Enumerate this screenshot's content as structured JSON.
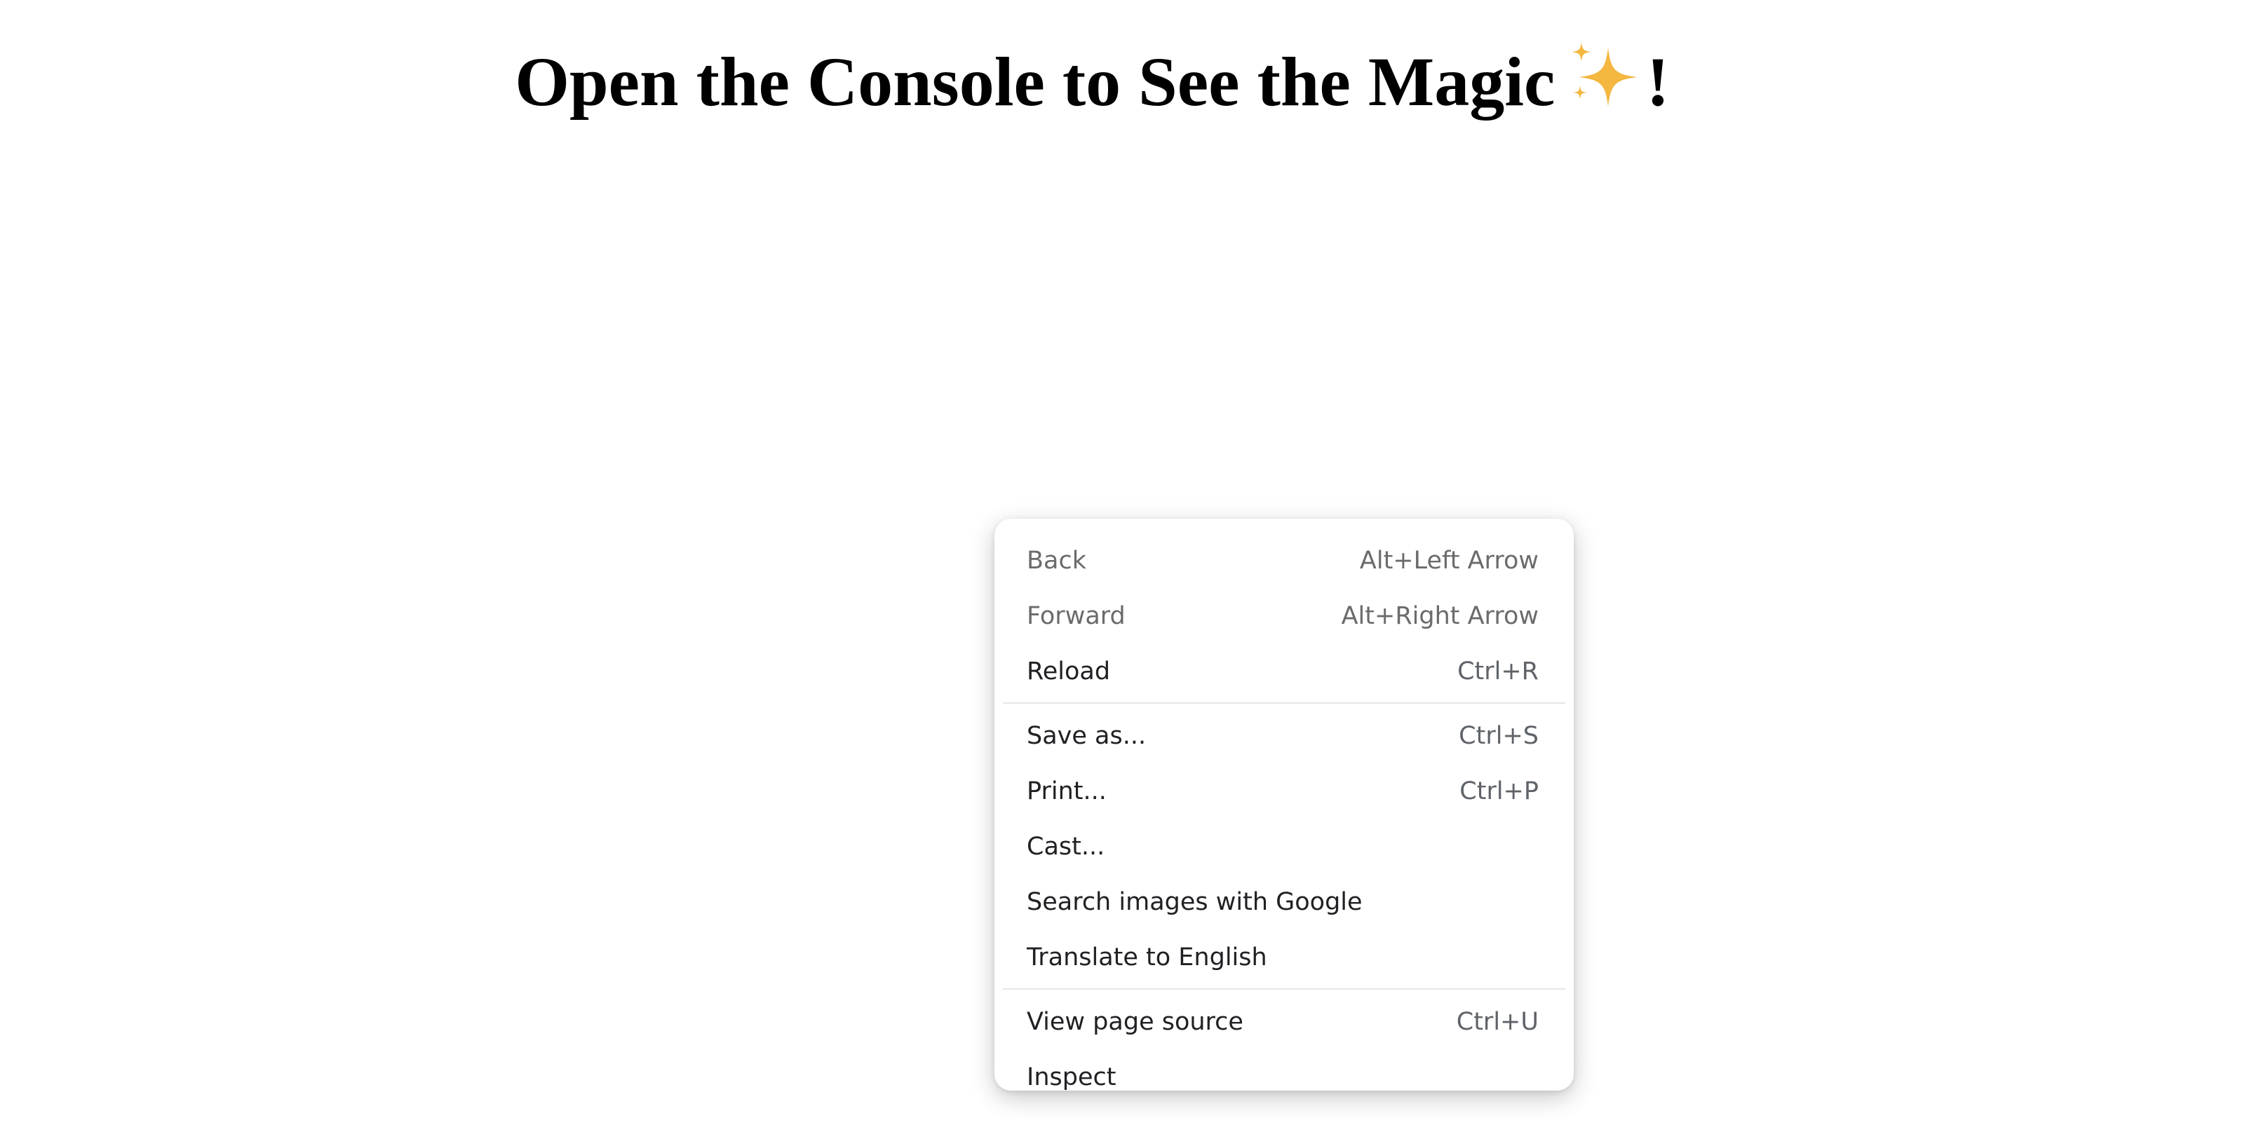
{
  "page": {
    "heading": "Open the Console to See the Magic",
    "heading_suffix": "!",
    "heading_icon": "sparkles-emoji",
    "accent_color": "#F4B73F"
  },
  "context_menu": {
    "groups": [
      {
        "items": [
          {
            "label": "Back",
            "shortcut": "Alt+Left Arrow",
            "enabled": false
          },
          {
            "label": "Forward",
            "shortcut": "Alt+Right Arrow",
            "enabled": false
          },
          {
            "label": "Reload",
            "shortcut": "Ctrl+R",
            "enabled": true
          }
        ]
      },
      {
        "items": [
          {
            "label": "Save as...",
            "shortcut": "Ctrl+S",
            "enabled": true
          },
          {
            "label": "Print...",
            "shortcut": "Ctrl+P",
            "enabled": true
          },
          {
            "label": "Cast...",
            "shortcut": "",
            "enabled": true
          },
          {
            "label": "Search images with Google",
            "shortcut": "",
            "enabled": true
          },
          {
            "label": "Translate to English",
            "shortcut": "",
            "enabled": true
          }
        ]
      },
      {
        "items": [
          {
            "label": "View page source",
            "shortcut": "Ctrl+U",
            "enabled": true
          },
          {
            "label": "Inspect",
            "shortcut": "",
            "enabled": true
          }
        ]
      }
    ]
  }
}
